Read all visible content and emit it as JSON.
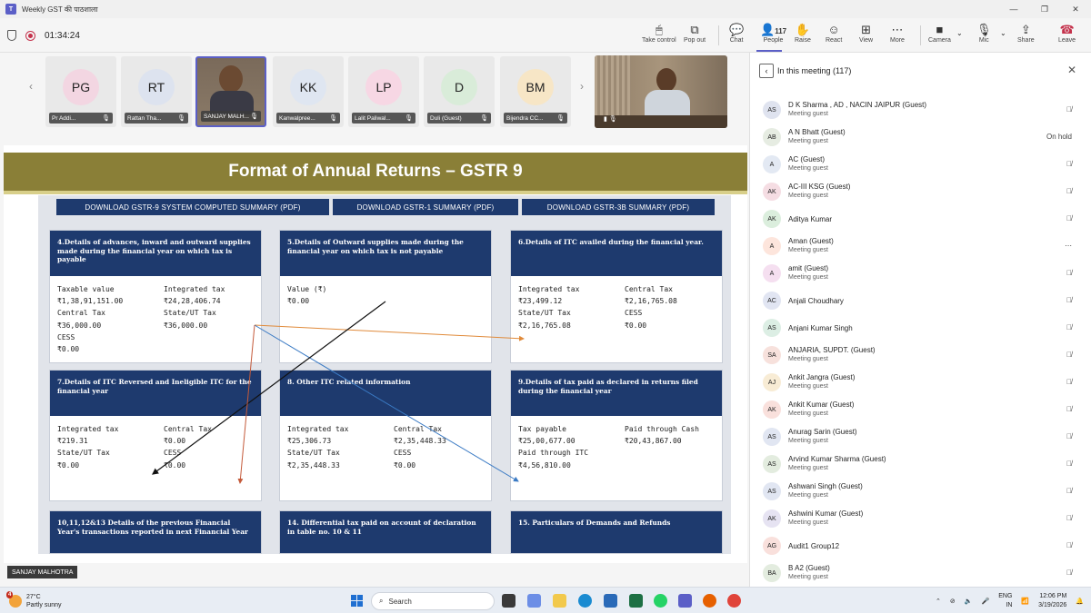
{
  "window": {
    "title": "Weekly GST की पाठशाला"
  },
  "meeting": {
    "timer": "01:34:24"
  },
  "toolbar": {
    "take_control": "Take control",
    "pop_out": "Pop out",
    "chat": "Chat",
    "people": "People",
    "people_count": "117",
    "raise": "Raise",
    "react": "React",
    "view": "View",
    "more": "More",
    "camera": "Camera",
    "mic": "Mic",
    "share": "Share",
    "leave": "Leave"
  },
  "participants": [
    {
      "initials": "PG",
      "name": "Pr Addi...",
      "color": "#f3d6e2"
    },
    {
      "initials": "RT",
      "name": "Rattan Tha...",
      "color": "#dde3ef"
    },
    {
      "initials": "",
      "name": "SANJAY MALH...",
      "color": ""
    },
    {
      "initials": "KK",
      "name": "Kanwalpree...",
      "color": "#dfe6f1"
    },
    {
      "initials": "LP",
      "name": "Lalit Paliwal...",
      "color": "#f7d7e4"
    },
    {
      "initials": "D",
      "name": "Duli (Guest)",
      "color": "#d9ecd9"
    },
    {
      "initials": "BM",
      "name": "Bijendra CC...",
      "color": "#f7e6c6"
    }
  ],
  "slide": {
    "title": "Format of Annual Returns – GSTR 9",
    "downloads": [
      "DOWNLOAD GSTR-9 SYSTEM COMPUTED SUMMARY (PDF)",
      "DOWNLOAD GSTR-1 SUMMARY (PDF)",
      "DOWNLOAD GSTR-3B SUMMARY (PDF)"
    ],
    "cards": [
      {
        "title": "4.Details of advances, inward and outward supplies made during the financial year on which tax is payable",
        "lines": [
          "Taxable value",
          "Integrated tax",
          "₹1,38,91,151.00",
          "₹24,28,406.74",
          "Central Tax",
          "State/UT Tax",
          "₹36,000.00",
          "₹36,000.00",
          "CESS",
          "",
          "₹0.00",
          ""
        ]
      },
      {
        "title": "5.Details of Outward supplies made during the financial year on which tax is not payable",
        "lines": [
          "Value (₹)",
          "",
          "₹0.00",
          ""
        ]
      },
      {
        "title": "6.Details of ITC availed during the financial year.",
        "lines": [
          "Integrated tax",
          "Central Tax",
          "₹23,499.12",
          "₹2,16,765.08",
          "State/UT Tax",
          "CESS",
          "₹2,16,765.08",
          "₹0.00"
        ]
      },
      {
        "title": "7.Details of ITC Reversed and Ineligible ITC for the financial year",
        "lines": [
          "Integrated tax",
          "Central Tax",
          "₹219.31",
          "₹0.00",
          "State/UT Tax",
          "CESS",
          "₹0.00",
          "₹0.00"
        ]
      },
      {
        "title": "8. Other ITC related information",
        "lines": [
          "Integrated tax",
          "Central Tax",
          "₹25,306.73",
          "₹2,35,448.33",
          "State/UT Tax",
          "CESS",
          "₹2,35,448.33",
          "₹0.00"
        ]
      },
      {
        "title": "9.Details of tax paid as declared in returns filed during the financial year",
        "lines": [
          "Tax payable",
          "Paid through Cash",
          "₹25,00,677.00",
          "₹20,43,867.00",
          "Paid through ITC",
          "",
          "₹4,56,810.00",
          ""
        ]
      },
      {
        "title": "10,11,12&13 Details of the previous Financial Year's transactions reported in next Financial Year",
        "lines": []
      },
      {
        "title": "14. Differential tax paid on account of declaration in table no. 10 & 11",
        "lines": []
      },
      {
        "title": "15. Particulars of Demands and Refunds",
        "lines": []
      }
    ]
  },
  "presenter": "SANJAY MALHOTRA",
  "panel": {
    "header": "In this meeting (117)",
    "people": [
      {
        "initials": "AS",
        "name": "D K Sharma , AD , NACIN JAIPUR (Guest)",
        "role": "Meeting guest",
        "status": "mic-off",
        "color": "#dfe3ef"
      },
      {
        "initials": "AB",
        "name": "A N Bhatt (Guest)",
        "role": "Meeting guest",
        "status": "On hold",
        "color": "#e6ece2"
      },
      {
        "initials": "A",
        "name": "AC (Guest)",
        "role": "Meeting guest",
        "status": "mic-off",
        "color": "#e3e9f3"
      },
      {
        "initials": "AK",
        "name": "AC-III KSG (Guest)",
        "role": "Meeting guest",
        "status": "mic-off",
        "color": "#f5dde3"
      },
      {
        "initials": "AK",
        "name": "Aditya Kumar",
        "role": "",
        "status": "mic-off",
        "color": "#dbeedd"
      },
      {
        "initials": "A",
        "name": "Aman (Guest)",
        "role": "Meeting guest",
        "status": "more",
        "color": "#fde5dc"
      },
      {
        "initials": "A",
        "name": "amit (Guest)",
        "role": "Meeting guest",
        "status": "mic-off",
        "color": "#f5dff0"
      },
      {
        "initials": "AC",
        "name": "Anjali Choudhary",
        "role": "",
        "status": "mic-off",
        "color": "#e1e5f2"
      },
      {
        "initials": "AS",
        "name": "Anjani Kumar Singh",
        "role": "",
        "status": "mic-off",
        "color": "#dceee4"
      },
      {
        "initials": "SA",
        "name": "ANJARIA, SUPDT. (Guest)",
        "role": "Meeting guest",
        "status": "mic-off",
        "color": "#f7e1dc"
      },
      {
        "initials": "AJ",
        "name": "Ankit Jangra (Guest)",
        "role": "Meeting guest",
        "status": "mic-off",
        "color": "#f8ecd5"
      },
      {
        "initials": "AK",
        "name": "Ankit Kumar (Guest)",
        "role": "Meeting guest",
        "status": "mic-off",
        "color": "#f9e0dc"
      },
      {
        "initials": "AS",
        "name": "Anurag Sarin (Guest)",
        "role": "Meeting guest",
        "status": "mic-off",
        "color": "#e1e6f2"
      },
      {
        "initials": "AS",
        "name": "Arvind Kumar Sharma (Guest)",
        "role": "Meeting guest",
        "status": "mic-off",
        "color": "#e3ecdf"
      },
      {
        "initials": "AS",
        "name": "Ashwani Singh (Guest)",
        "role": "Meeting guest",
        "status": "mic-off",
        "color": "#e1e6f2"
      },
      {
        "initials": "AK",
        "name": "Ashwini Kumar (Guest)",
        "role": "Meeting guest",
        "status": "mic-off",
        "color": "#e6e3f2"
      },
      {
        "initials": "AG",
        "name": "Audit1 Group12",
        "role": "",
        "status": "mic-off",
        "color": "#f9e0dc"
      },
      {
        "initials": "BA",
        "name": "B A2 (Guest)",
        "role": "Meeting guest",
        "status": "mic-off",
        "color": "#e3ecdf"
      }
    ]
  },
  "taskbar": {
    "temp": "27°C",
    "weather": "Partly sunny",
    "alert": "4",
    "search_placeholder": "Search",
    "lang1": "ENG",
    "lang2": "IN",
    "time": "12:06 PM",
    "date": "3/19/2026"
  }
}
